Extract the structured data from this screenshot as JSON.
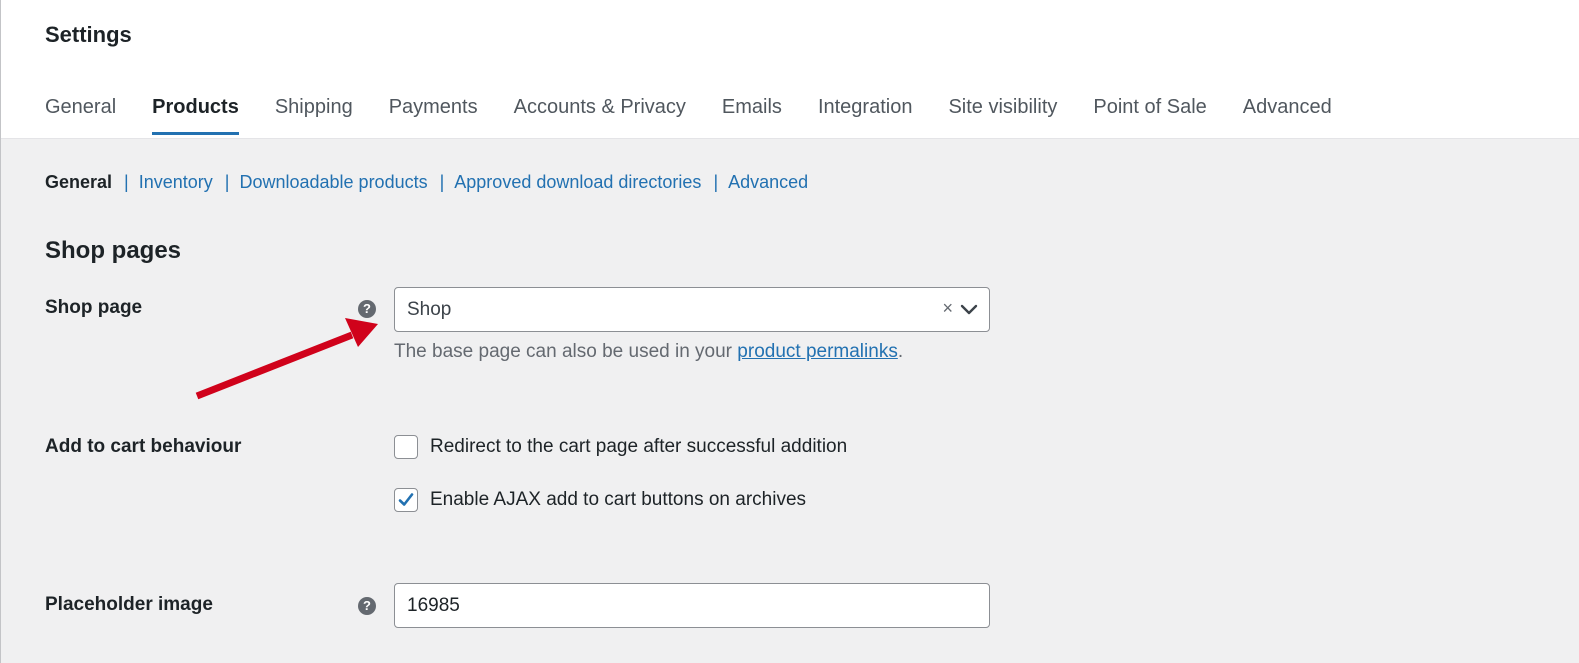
{
  "page": {
    "title": "Settings"
  },
  "tabs": [
    {
      "label": "General"
    },
    {
      "label": "Products"
    },
    {
      "label": "Shipping"
    },
    {
      "label": "Payments"
    },
    {
      "label": "Accounts & Privacy"
    },
    {
      "label": "Emails"
    },
    {
      "label": "Integration"
    },
    {
      "label": "Site visibility"
    },
    {
      "label": "Point of Sale"
    },
    {
      "label": "Advanced"
    }
  ],
  "active_tab": "Products",
  "subnav": {
    "current": "General",
    "links": [
      {
        "label": "Inventory"
      },
      {
        "label": "Downloadable products"
      },
      {
        "label": "Approved download directories"
      },
      {
        "label": "Advanced"
      }
    ],
    "separator": "|"
  },
  "section": {
    "title": "Shop pages"
  },
  "shop_page": {
    "label": "Shop page",
    "help_glyph": "?",
    "selected_value": "Shop",
    "clear_glyph": "×",
    "description_prefix": "The base page can also be used in your ",
    "description_link": "product permalinks",
    "description_suffix": "."
  },
  "add_to_cart": {
    "label": "Add to cart behaviour",
    "options": [
      {
        "label": "Redirect to the cart page after successful addition",
        "checked": false
      },
      {
        "label": "Enable AJAX add to cart buttons on archives",
        "checked": true
      }
    ]
  },
  "placeholder_image": {
    "label": "Placeholder image",
    "help_glyph": "?",
    "value": "16985"
  },
  "colors": {
    "accent": "#2271b1",
    "arrow": "#d0021b"
  },
  "icons": {
    "help": "help-icon",
    "chevron": "chevron-down-icon",
    "clear": "clear-icon",
    "check": "checkmark-icon",
    "annotation": "red-arrow-icon"
  }
}
